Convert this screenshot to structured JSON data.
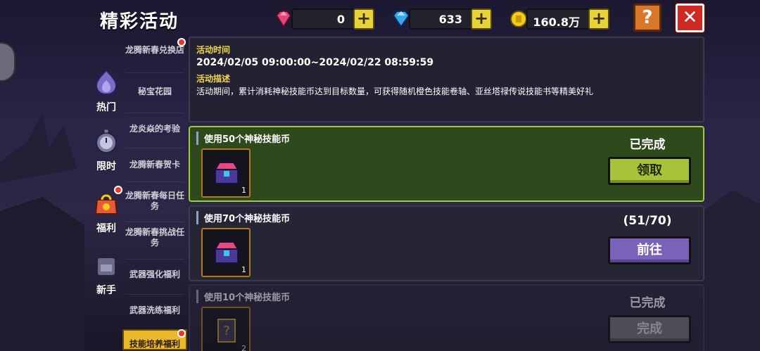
{
  "header": {
    "title": "精彩活动",
    "currencies": [
      {
        "name": "gem-pink",
        "value": "0",
        "color": "#e8447a"
      },
      {
        "name": "diamond-blue",
        "value": "633",
        "color": "#39a8e8"
      },
      {
        "name": "gold-coin",
        "value": "160.8万",
        "color": "#f2cc1a"
      }
    ],
    "plus_label": "+",
    "help_label": "?",
    "close_label": "✕"
  },
  "categories": [
    {
      "label": "热门",
      "icon": "purple-flame-icon"
    },
    {
      "label": "限时",
      "icon": "stopwatch-icon"
    },
    {
      "label": "福利",
      "icon": "gift-bag-icon",
      "badge": true
    },
    {
      "label": "新手",
      "icon": "backpack-icon"
    }
  ],
  "submenu": [
    {
      "label": "龙腾新春兑换店",
      "badge": true
    },
    {
      "label": "秘宝花园"
    },
    {
      "label": "龙炎焱的考验"
    },
    {
      "label": "龙腾新春贺卡"
    },
    {
      "label": "龙腾新春每日任务"
    },
    {
      "label": "龙腾新春挑战任务"
    },
    {
      "label": "武器强化福利"
    },
    {
      "label": "武器洗练福利"
    },
    {
      "label": "技能培养福利",
      "active": true,
      "badge": true
    }
  ],
  "info": {
    "time_label": "活动时间",
    "time_value": "2024/02/05 09:00:00~2024/02/22 08:59:59",
    "desc_label": "活动描述",
    "desc_value": "活动期间，累计消耗神秘技能币达到目标数量，可获得随机橙色技能卷轴、亚丝塔禄传说技能书等精美好礼"
  },
  "tasks": [
    {
      "title": "使用50个神秘技能币",
      "reward_qty": "1",
      "reward_icon": "skill-chest-icon",
      "status": "已完成",
      "button": "领取"
    },
    {
      "title": "使用70个神秘技能币",
      "reward_qty": "1",
      "reward_icon": "skill-chest-icon",
      "status": "(51/70)",
      "button": "前往"
    },
    {
      "title": "使用10个神秘技能币",
      "reward_qty": "2",
      "reward_icon": "skill-scroll-icon",
      "status": "已完成",
      "button": "完成"
    }
  ]
}
